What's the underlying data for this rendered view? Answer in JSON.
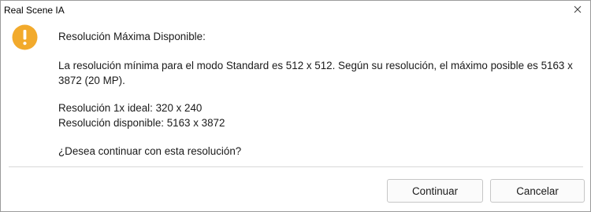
{
  "window": {
    "title": "Real Scene IA"
  },
  "dialog": {
    "icon": "warning-icon",
    "heading": "Resolución Máxima Disponible:",
    "description_line1": "La resolución mínima para el modo Standard es 512 x 512. Según su resolución, el máximo posible es 5163 x",
    "description_line2": "3872 (20 MP).",
    "ideal_resolution": "Resolución 1x ideal: 320 x 240",
    "available_resolution": "Resolución disponible: 5163 x 3872",
    "question": "¿Desea continuar con esta resolución?"
  },
  "buttons": {
    "continue_label": "Continuar",
    "cancel_label": "Cancelar"
  },
  "colors": {
    "warning": "#F2AA2C",
    "border": "#9b9b9b"
  }
}
